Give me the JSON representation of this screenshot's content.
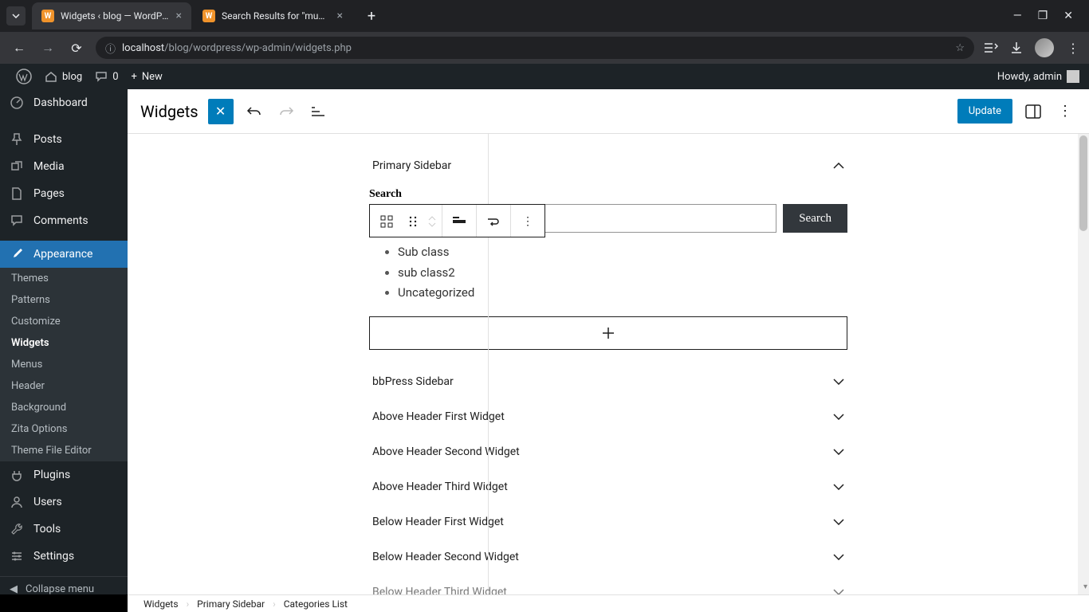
{
  "browser": {
    "tabs": [
      {
        "title": "Widgets ‹ blog — WordPress",
        "active": true
      },
      {
        "title": "Search Results for \"mumbai\" –",
        "active": false
      }
    ],
    "url_host": "localhost",
    "url_path": "/blog/wordpress/wp-admin/widgets.php",
    "info_icon": "ⓘ"
  },
  "admin_bar": {
    "site": "blog",
    "comments": "0",
    "new": "New",
    "howdy": "Howdy, admin"
  },
  "sidebar": {
    "items": [
      {
        "icon": "dashboard",
        "label": "Dashboard",
        "current": false
      },
      {
        "icon": "posts",
        "label": "Posts",
        "current": false
      },
      {
        "icon": "media",
        "label": "Media",
        "current": false
      },
      {
        "icon": "pages",
        "label": "Pages",
        "current": false
      },
      {
        "icon": "comments",
        "label": "Comments",
        "current": false
      },
      {
        "icon": "appearance",
        "label": "Appearance",
        "current": true
      },
      {
        "icon": "plugins",
        "label": "Plugins",
        "current": false
      },
      {
        "icon": "users",
        "label": "Users",
        "current": false
      },
      {
        "icon": "tools",
        "label": "Tools",
        "current": false
      },
      {
        "icon": "settings",
        "label": "Settings",
        "current": false
      }
    ],
    "submenu": [
      "Themes",
      "Patterns",
      "Customize",
      "Widgets",
      "Menus",
      "Header",
      "Background",
      "Zita Options",
      "Theme File Editor"
    ],
    "submenu_current": "Widgets",
    "collapse": "Collapse menu"
  },
  "editor": {
    "title": "Widgets",
    "update": "Update"
  },
  "primary": {
    "title": "Primary Sidebar",
    "search_label": "Search",
    "search_button": "Search",
    "categories": [
      "Sub class",
      "sub class2",
      "Uncategorized"
    ]
  },
  "areas": [
    "bbPress Sidebar",
    "Above Header First Widget",
    "Above Header Second Widget",
    "Above Header Third Widget",
    "Below Header First Widget",
    "Below Header Second Widget",
    "Below Header Third Widget"
  ],
  "breadcrumb": [
    "Widgets",
    "Primary Sidebar",
    "Categories List"
  ]
}
